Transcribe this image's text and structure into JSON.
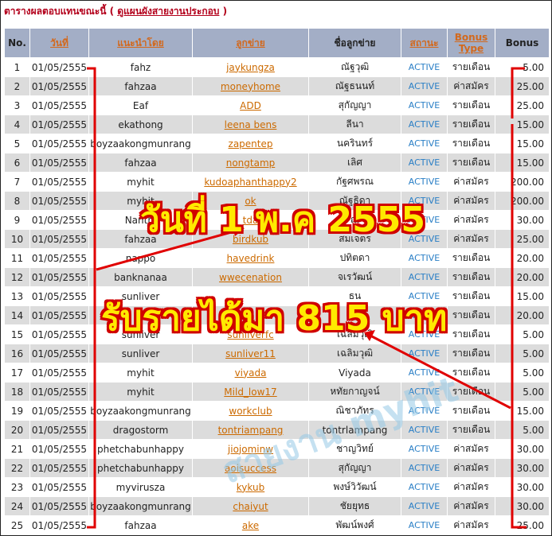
{
  "heading": {
    "text": "ตารางผลตอบแทนขณะนี้ (",
    "link": "ดูแผนผังสายงานประกอบ",
    "close": ")"
  },
  "columns": [
    {
      "label": "No.",
      "link": false
    },
    {
      "label": "วันที่",
      "link": true
    },
    {
      "label": "แนะนำโดย",
      "link": true
    },
    {
      "label": "ลูกข่าย",
      "link": true
    },
    {
      "label": "ชื่อลูกข่าย",
      "link": false
    },
    {
      "label": "สถานะ",
      "link": true
    },
    {
      "label": "Bonus Type",
      "link": true
    },
    {
      "label": "Bonus",
      "link": false
    }
  ],
  "rows": [
    {
      "no": "1",
      "date": "01/05/2555",
      "ref": "fahz",
      "member": "jaykungza",
      "name": "ณัฐวุฒิ",
      "status": "ACTIVE",
      "type": "รายเดือน",
      "bonus": "5.00"
    },
    {
      "no": "2",
      "date": "01/05/2555",
      "ref": "fahzaa",
      "member": "moneyhome",
      "name": "ณัฐธนนท์",
      "status": "ACTIVE",
      "type": "ค่าสมัคร",
      "bonus": "25.00"
    },
    {
      "no": "3",
      "date": "01/05/2555",
      "ref": "Eaf",
      "member": "ADD",
      "name": "สุกัญญา",
      "status": "ACTIVE",
      "type": "รายเดือน",
      "bonus": "25.00"
    },
    {
      "no": "4",
      "date": "01/05/2555",
      "ref": "ekathong",
      "member": "leena bens",
      "name": "ลีนา",
      "status": "ACTIVE",
      "type": "รายเดือน",
      "bonus": "15.00"
    },
    {
      "no": "5",
      "date": "01/05/2555",
      "ref": "boyzaakongmunrang",
      "member": "zapentep",
      "name": "นครินทร์",
      "status": "ACTIVE",
      "type": "รายเดือน",
      "bonus": "15.00"
    },
    {
      "no": "6",
      "date": "01/05/2555",
      "ref": "fahzaa",
      "member": "nongtamp",
      "name": "เลิศ",
      "status": "ACTIVE",
      "type": "รายเดือน",
      "bonus": "15.00"
    },
    {
      "no": "7",
      "date": "01/05/2555",
      "ref": "myhit",
      "member": "kudoaphanthappy2",
      "name": "กัฐศพรณ",
      "status": "ACTIVE",
      "type": "ค่าสมัคร",
      "bonus": "200.00"
    },
    {
      "no": "8",
      "date": "01/05/2555",
      "ref": "myhit",
      "member": "ok",
      "name": "ณัฐธิดา",
      "status": "ACTIVE",
      "type": "ค่าสมัคร",
      "bonus": "200.00"
    },
    {
      "no": "9",
      "date": "01/05/2555",
      "ref": "Nanthi",
      "member": "tda",
      "name": "ณิ",
      "status": "ACTIVE",
      "type": "ค่าสมัคร",
      "bonus": "30.00"
    },
    {
      "no": "10",
      "date": "01/05/2555",
      "ref": "fahzaa",
      "member": "birdkub",
      "name": "สมเจตร",
      "status": "ACTIVE",
      "type": "ค่าสมัคร",
      "bonus": "25.00"
    },
    {
      "no": "11",
      "date": "01/05/2555",
      "ref": "nappo",
      "member": "havedrink",
      "name": "ปทิตดา",
      "status": "ACTIVE",
      "type": "รายเดือน",
      "bonus": "20.00"
    },
    {
      "no": "12",
      "date": "01/05/2555",
      "ref": "banknanaa",
      "member": "wwecenation",
      "name": "จเรวัฒน์",
      "status": "ACTIVE",
      "type": "รายเดือน",
      "bonus": "20.00"
    },
    {
      "no": "13",
      "date": "01/05/2555",
      "ref": "sunliver",
      "member": "",
      "name": "ธน",
      "status": "ACTIVE",
      "type": "รายเดือน",
      "bonus": "15.00"
    },
    {
      "no": "14",
      "date": "01/05/2555",
      "ref": "",
      "member": "la",
      "name": "น",
      "status": "ACTIVE",
      "type": "รายเดือน",
      "bonus": "20.00"
    },
    {
      "no": "15",
      "date": "01/05/2555",
      "ref": "sunliver",
      "member": "sunliverfc",
      "name": "เฉลิมวุฒิ",
      "status": "ACTIVE",
      "type": "รายเดือน",
      "bonus": "5.00"
    },
    {
      "no": "16",
      "date": "01/05/2555",
      "ref": "sunliver",
      "member": "sunliver11",
      "name": "เฉลิมวุฒิ",
      "status": "ACTIVE",
      "type": "รายเดือน",
      "bonus": "5.00"
    },
    {
      "no": "17",
      "date": "01/05/2555",
      "ref": "myhit",
      "member": "viyada",
      "name": "Viyada",
      "status": "ACTIVE",
      "type": "รายเดือน",
      "bonus": "5.00"
    },
    {
      "no": "18",
      "date": "01/05/2555",
      "ref": "myhit",
      "member": "Mild_low17",
      "name": "หทัยกาญจน์",
      "status": "ACTIVE",
      "type": "รายเดือน",
      "bonus": "5.00"
    },
    {
      "no": "19",
      "date": "01/05/2555",
      "ref": "boyzaakongmunrang",
      "member": "workclub",
      "name": "ณิชาภัทร",
      "status": "ACTIVE",
      "type": "รายเดือน",
      "bonus": "15.00"
    },
    {
      "no": "20",
      "date": "01/05/2555",
      "ref": "dragostorm",
      "member": "tontriampang",
      "name": "tontrlampang",
      "status": "ACTIVE",
      "type": "รายเดือน",
      "bonus": "5.00"
    },
    {
      "no": "21",
      "date": "01/05/2555",
      "ref": "phetchabunhappy",
      "member": "jiojominw",
      "name": "ชาญวิทย์",
      "status": "ACTIVE",
      "type": "ค่าสมัคร",
      "bonus": "30.00"
    },
    {
      "no": "22",
      "date": "01/05/2555",
      "ref": "phetchabunhappy",
      "member": "aoisuccess",
      "name": "สุกัญญา",
      "status": "ACTIVE",
      "type": "ค่าสมัคร",
      "bonus": "30.00"
    },
    {
      "no": "23",
      "date": "01/05/2555",
      "ref": "myvirusza",
      "member": "kykub",
      "name": "พงษ์วิวัฒน์",
      "status": "ACTIVE",
      "type": "ค่าสมัคร",
      "bonus": "30.00"
    },
    {
      "no": "24",
      "date": "01/05/2555",
      "ref": "boyzaakongmunrang",
      "member": "chaiyut",
      "name": "ชัยยุทธ",
      "status": "ACTIVE",
      "type": "ค่าสมัคร",
      "bonus": "30.00"
    },
    {
      "no": "25",
      "date": "01/05/2555",
      "ref": "fahzaa",
      "member": "ake",
      "name": "พัฒน์พงศ์",
      "status": "ACTIVE",
      "type": "ค่าสมัคร",
      "bonus": "25.00"
    }
  ],
  "overlay": {
    "date_text": "วันที่ 1 พ.ค 2555",
    "income_text": "รับรายได้มา 815 บาท",
    "watermark": "สายงาน myhit"
  },
  "colors": {
    "header_bg": "#a3aec6",
    "row_alt": "#dcdcdc",
    "link": "#cc6a00",
    "status": "#2a7fc6",
    "heading": "#b3001b",
    "overlay_fill": "#ffea00",
    "overlay_stroke": "#d00000"
  }
}
